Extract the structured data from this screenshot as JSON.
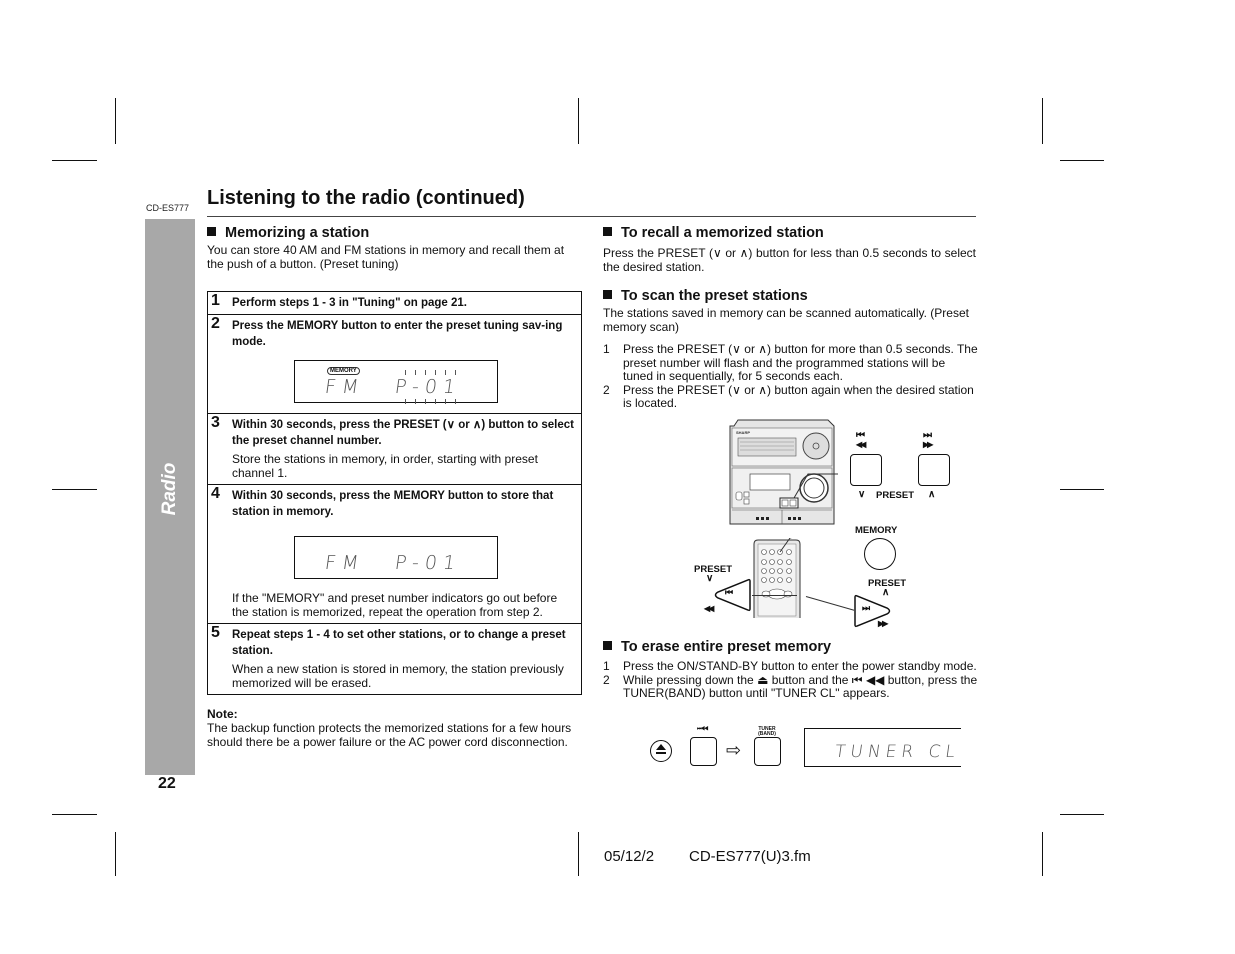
{
  "header": {
    "model_small": "CD-ES777",
    "title": "Listening to the radio (continued)"
  },
  "sidetab": {
    "label": "Radio"
  },
  "page_number": "22",
  "memorizing": {
    "heading": "Memorizing a station",
    "intro": "You can store 40 AM and FM stations in memory and recall them at the push of a button. (Preset tuning)",
    "steps": [
      {
        "num": "1",
        "main": "Perform steps 1 - 3 in \"Tuning\" on page 21.",
        "sub": ""
      },
      {
        "num": "2",
        "main": "Press the MEMORY button to enter the preset tuning sav-ing mode.",
        "sub": ""
      },
      {
        "num": "3",
        "main": "Within 30 seconds, press the PRESET (∨ or ∧) button to select the preset channel number.",
        "sub": "Store the stations in memory, in order, starting with preset channel 1."
      },
      {
        "num": "4",
        "main": "Within 30 seconds, press the MEMORY button to store that station in memory.",
        "sub": "If the \"MEMORY\" and preset number indicators go out before the station is memorized, repeat the operation from step 2."
      },
      {
        "num": "5",
        "main": "Repeat steps 1 - 4 to set other stations, or to change a preset station.",
        "sub": "When a new station is stored in memory, the station previously memorized will be erased."
      }
    ],
    "lcd1": {
      "badge": "MEMORY",
      "band": "FM",
      "preset": "P-01"
    },
    "lcd2": {
      "band": "FM",
      "preset": "P-01"
    },
    "note_label": "Note:",
    "note_text": "The backup function protects the memorized stations for a few hours should there be a power failure or the AC power cord disconnection."
  },
  "recall": {
    "heading": "To recall a memorized station",
    "text": "Press the PRESET (∨ or ∧) button for less than 0.5 seconds to select the desired station."
  },
  "scan": {
    "heading": "To scan the preset stations",
    "intro": "The stations saved in memory can be scanned automatically. (Preset memory scan)",
    "items": [
      {
        "n": "1",
        "text": "Press the PRESET (∨ or ∧) button for more than 0.5 seconds. The preset number will flash and the programmed stations will be tuned in sequentially, for 5 seconds each."
      },
      {
        "n": "2",
        "text": "Press the PRESET (∨ or ∧) button again when the desired station is located."
      }
    ]
  },
  "illustration": {
    "preset_down_glyph": "⏮◀◀",
    "skip_back": "⏮",
    "rewind": "◀◀",
    "skip_fwd": "⏭",
    "ffwd": "▶▶",
    "preset_label": "PRESET",
    "preset_down": "∨",
    "preset_up": "∧",
    "memory_label": "MEMORY",
    "brand": "SHARP"
  },
  "erase": {
    "heading": "To erase entire preset memory",
    "items": [
      {
        "n": "1",
        "text": "Press the ON/STAND-BY button to enter the power standby mode."
      },
      {
        "n": "2",
        "text": "While pressing down the ⏏ button and the ⏮ ◀◀ button, press the TUNER(BAND) button until \"TUNER CL\" appears."
      }
    ],
    "tuner_label": "TUNER (BAND)",
    "lcd": "TUNER CL",
    "arrow": "⇨"
  },
  "footer": {
    "date": "05/12/2",
    "file": "CD-ES777(U)3.fm"
  }
}
